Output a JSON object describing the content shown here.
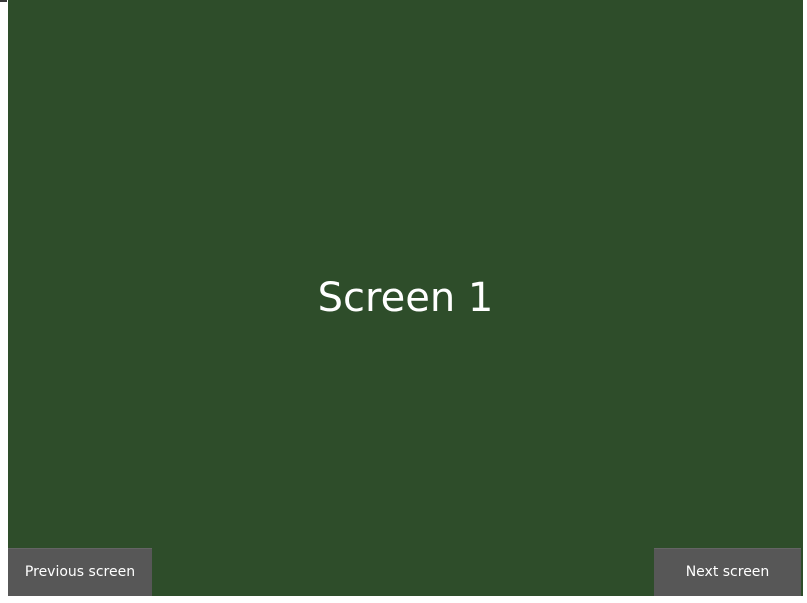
{
  "screen": {
    "title": "Screen 1",
    "background_color": "#2e4d2a"
  },
  "navigation": {
    "previous_label": "Previous screen",
    "next_label": "Next screen",
    "button_color": "#575757"
  }
}
